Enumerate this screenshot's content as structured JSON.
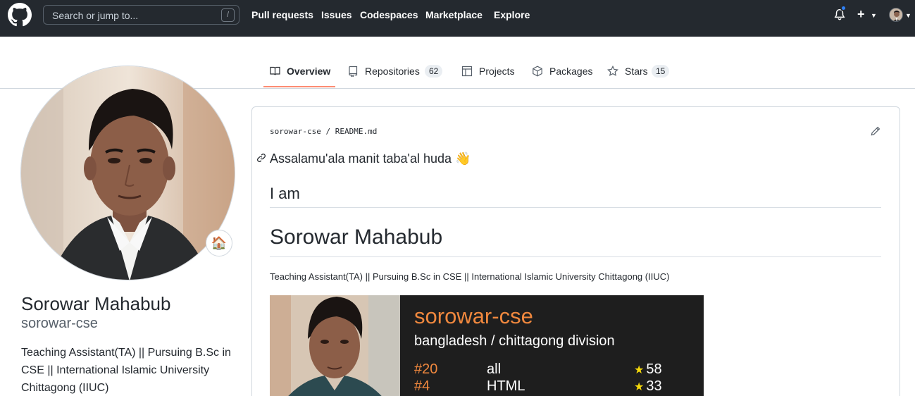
{
  "header": {
    "search_placeholder": "Search or jump to...",
    "search_shortcut": "/",
    "nav": [
      "Pull requests",
      "Issues",
      "Codespaces",
      "Marketplace",
      "Explore"
    ],
    "plus": "+"
  },
  "tabs": [
    {
      "label": "Overview",
      "icon": "book-icon",
      "selected": true
    },
    {
      "label": "Repositories",
      "icon": "repo-icon",
      "count": "62"
    },
    {
      "label": "Projects",
      "icon": "table-icon"
    },
    {
      "label": "Packages",
      "icon": "package-icon"
    },
    {
      "label": "Stars",
      "icon": "star-icon",
      "count": "15"
    }
  ],
  "profile": {
    "full_name": "Sorowar Mahabub",
    "login": "sorowar-cse",
    "bio": "Teaching Assistant(TA) || Pursuing B.Sc in CSE || International Islamic University Chittagong (IIUC)",
    "status_emoji": "🏠"
  },
  "readme": {
    "owner": "sorowar-cse",
    "separator": "/",
    "file": "README.md",
    "greeting": "Assalamu'ala manit taba'al huda",
    "greeting_emoji": "👋",
    "heading_1": "I am",
    "heading_2": "Sorowar Mahabub",
    "bio": "Teaching Assistant(TA) || Pursuing B.Sc in CSE || International Islamic University Chittagong (IIUC)"
  },
  "stats_card": {
    "username": "sorowar-cse",
    "location": "bangladesh / chittagong division",
    "rows": [
      {
        "rank": "#20",
        "label": "all",
        "stars": "58"
      },
      {
        "rank": "#4",
        "label": "HTML",
        "stars": "33"
      }
    ],
    "star_glyph": "★"
  },
  "colors": {
    "header_bg": "#24292f",
    "tab_underline": "#fd8c73",
    "card_bg": "#1e1e1e",
    "card_accent": "#f0883e",
    "notification_dot": "#2f81f7"
  }
}
